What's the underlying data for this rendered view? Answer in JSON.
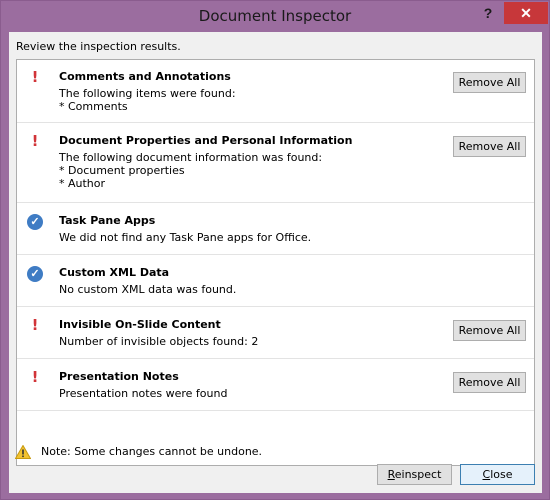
{
  "window": {
    "title": "Document Inspector",
    "help_glyph": "?",
    "close_glyph": "✕"
  },
  "instructions": "Review the inspection results.",
  "results": [
    {
      "status": "warning",
      "title": "Comments and Annotations",
      "lines": [
        "The following items were found:",
        "* Comments"
      ],
      "button": "Remove All"
    },
    {
      "status": "warning",
      "title": "Document Properties and Personal Information",
      "lines": [
        "The following document information was found:",
        "* Document properties",
        "* Author"
      ],
      "button": "Remove All"
    },
    {
      "status": "ok",
      "title": "Task Pane Apps",
      "lines": [
        "We did not find any Task Pane apps for Office."
      ],
      "button": ""
    },
    {
      "status": "ok",
      "title": "Custom XML Data",
      "lines": [
        "No custom XML data was found."
      ],
      "button": ""
    },
    {
      "status": "warning",
      "title": "Invisible On-Slide Content",
      "lines": [
        "Number of invisible objects found: 2"
      ],
      "button": "Remove All"
    },
    {
      "status": "warning",
      "title": "Presentation Notes",
      "lines": [
        "Presentation notes were found"
      ],
      "button": "Remove All"
    }
  ],
  "note": "Note: Some changes cannot be undone.",
  "footer": {
    "reinspect_label": "Reinspect",
    "close_label": "Close"
  },
  "colors": {
    "titlebar": "#9b6d9f",
    "warning": "#d13438",
    "ok": "#3f7cc4",
    "close_button": "#c7373a"
  },
  "icons": {
    "warning": "exclamation-icon",
    "ok": "checkmark-icon",
    "note": "warning-triangle-icon"
  }
}
